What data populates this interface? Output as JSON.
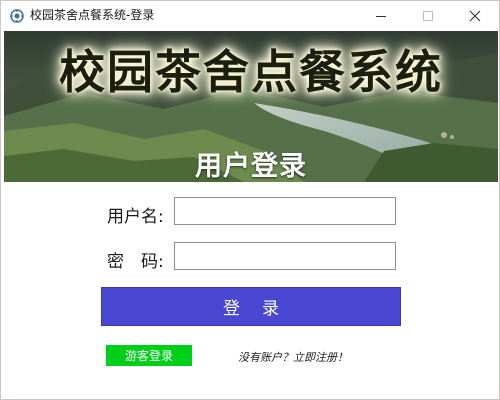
{
  "window": {
    "title": "校园茶舍点餐系统-登录",
    "controls": {
      "minimize_icon": "minimize-icon",
      "maximize_icon": "maximize-icon",
      "close_icon": "close-icon"
    }
  },
  "banner": {
    "title": "校园茶舍点餐系统",
    "subtitle": "用户登录"
  },
  "form": {
    "username_label": "用户名:",
    "username_value": "",
    "password_label": "密　码:",
    "password_value": ""
  },
  "actions": {
    "login_label": "登录",
    "guest_label": "游客登录",
    "register_text": "没有账户？立即注册！"
  },
  "colors": {
    "login_button": "#4a47d2",
    "guest_button": "#00cf1a",
    "banner_sky": "#2c3a2a",
    "river": "#b9c9c4"
  }
}
